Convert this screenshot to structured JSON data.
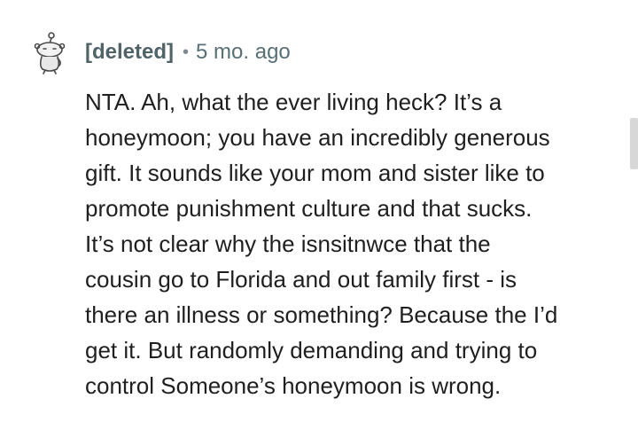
{
  "comment": {
    "author": "[deleted]",
    "separator": "•",
    "timestamp": "5 mo. ago",
    "avatar_icon": "deleted-user-snoo-icon",
    "body": "NTA. Ah, what the ever living heck? It’s a\nhoneymoon; you have an incredibly generous\ngift. It sounds like your mom and sister like to\npromote punishment culture and that sucks.\nIt’s not clear why the isnsitnwce that the\ncousin go to Florida and out family first - is\nthere an illness or something? Because the I’d\nget it. But randomly demanding and trying to\ncontrol Someone’s honeymoon is wrong."
  },
  "colors": {
    "meta_text": "#576f76",
    "body_text": "#1f1f1f",
    "scrollbar": "#d7d7d7"
  }
}
